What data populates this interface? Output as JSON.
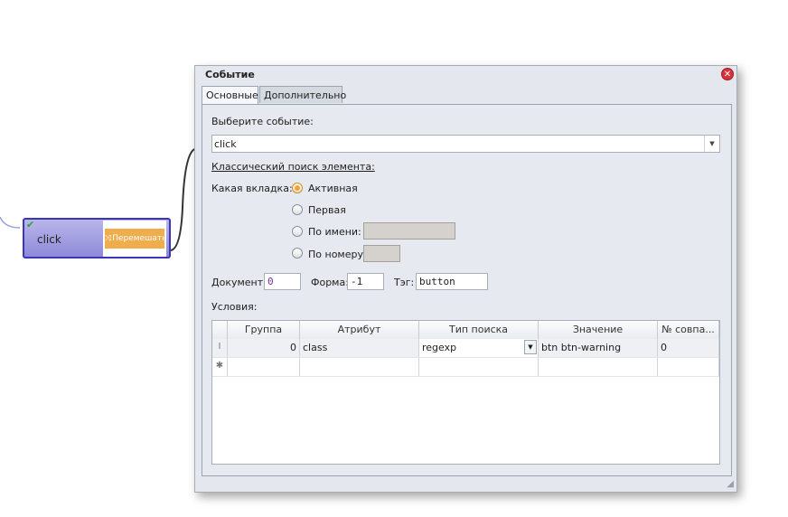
{
  "node": {
    "label": "click",
    "check_icon": "check-icon",
    "thumb_button_text": "Перемешать",
    "thumb_button_color": "#f0ad4e"
  },
  "dialog": {
    "title": "Событие",
    "tabs": [
      {
        "label": "Основные",
        "active": true
      },
      {
        "label": "Дополнительно",
        "active": false
      }
    ],
    "event_label": "Выберите событие:",
    "event_value": "click",
    "classic_search_label": "Классический поиск элемента:",
    "which_tab_label": "Какая вкладка:",
    "radio_options": [
      {
        "label": "Активная",
        "selected": true
      },
      {
        "label": "Первая",
        "selected": false
      },
      {
        "label": "По имени:",
        "selected": false
      },
      {
        "label": "По номеру:",
        "selected": false
      }
    ],
    "document_label": "Документ:",
    "document_value": "0",
    "form_label": "Форма:",
    "form_value": "-1",
    "tag_label": "Тэг:",
    "tag_value": "button",
    "conditions_label": "Условия:",
    "grid": {
      "columns": [
        "Группа",
        "Атрибут",
        "Тип поиска",
        "Значение",
        "№ совпа..."
      ],
      "rows": [
        {
          "indicator": "I",
          "group": "0",
          "attribute": "class",
          "search_type": "regexp",
          "value": "btn btn-warning",
          "match": "0"
        }
      ],
      "new_row_indicator": "✱"
    }
  }
}
